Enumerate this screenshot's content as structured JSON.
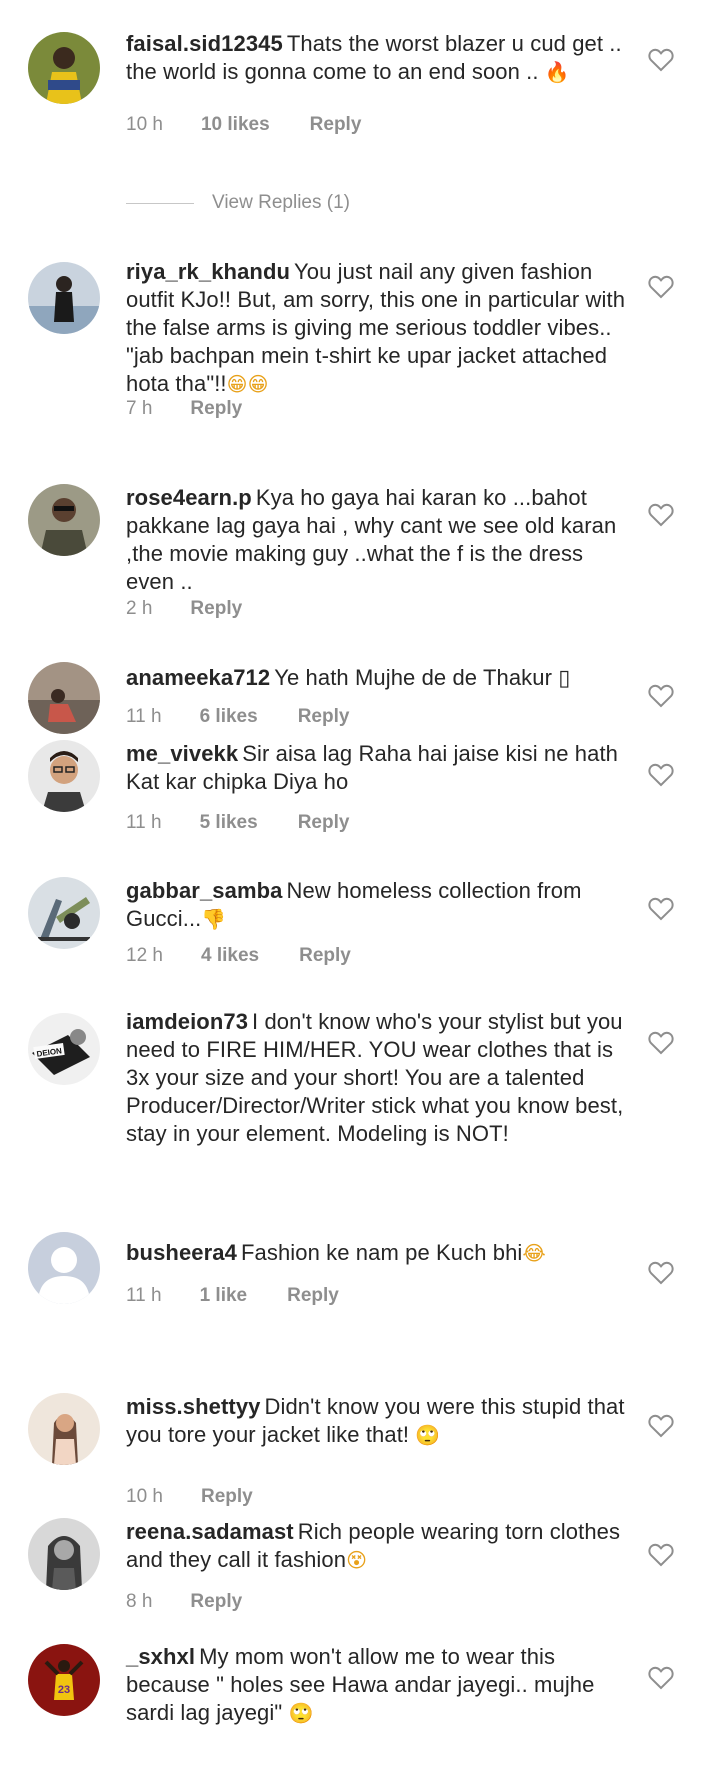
{
  "view_replies_label": "View Replies (1)",
  "comments": [
    {
      "username": "faisal.sid12345",
      "text": "Thats the worst blazer u cud get .. the world is gonna come to an end soon .. ",
      "emoji": "🔥",
      "time": "10 h",
      "likes": "10 likes",
      "reply": "Reply"
    },
    {
      "username": "riya_rk_khandu",
      "text": "You just nail any given fashion outfit KJo!! But, am sorry, this one in particular with the false arms is giving me serious toddler vibes.. \"jab bachpan mein t-shirt ke upar jacket attached hota tha\"!!",
      "emoji": "😁😁",
      "time": "7 h",
      "likes": "",
      "reply": "Reply"
    },
    {
      "username": "rose4earn.p",
      "text": "Kya ho gaya hai karan ko ...bahot pakkane lag gaya hai , why cant we see old karan ,the movie making guy ..what the f is the dress even ..",
      "emoji": "",
      "time": "2 h",
      "likes": "",
      "reply": "Reply"
    },
    {
      "username": "anameeka712",
      "text": "Ye hath Mujhe de de Thakur ",
      "emoji": "▯",
      "time": "11 h",
      "likes": "6 likes",
      "reply": "Reply"
    },
    {
      "username": "me_vivekk",
      "text": "Sir aisa lag Raha hai jaise kisi ne hath Kat kar chipka Diya ho",
      "emoji": "",
      "time": "11 h",
      "likes": "5 likes",
      "reply": "Reply"
    },
    {
      "username": "gabbar_samba",
      "text": "New homeless collection from Gucci...",
      "emoji": "👎",
      "time": "12 h",
      "likes": "4 likes",
      "reply": "Reply"
    },
    {
      "username": "iamdeion73",
      "text": "I don't know who's your stylist but you need to FIRE HIM/HER. YOU wear clothes that is 3x your size and your short! You are a talented Producer/Director/Writer stick what you know best, stay in your element. Modeling is NOT!",
      "emoji": "",
      "time": "",
      "likes": "",
      "reply": ""
    },
    {
      "username": "busheera4",
      "text": "Fashion ke nam pe Kuch bhi",
      "emoji": "😂",
      "time": "11 h",
      "likes": "1 like",
      "reply": "Reply"
    },
    {
      "username": "miss.shettyy",
      "text": "Didn't know you were this stupid that you tore your jacket like that! ",
      "emoji": "🙄",
      "time": "10 h",
      "likes": "",
      "reply": "Reply"
    },
    {
      "username": "reena.sadamast",
      "text": "Rich people wearing torn clothes and they call  it fashion",
      "emoji": "😵",
      "time": "8 h",
      "likes": "",
      "reply": "Reply"
    },
    {
      "username": "_sxhxl",
      "text": "My mom won't allow me to wear this because \" holes see Hawa andar jayegi.. mujhe sardi lag jayegi\" ",
      "emoji": "🙄",
      "time": "",
      "likes": "",
      "reply": ""
    }
  ],
  "avatar_text": {
    "iamdeion73": "DEION",
    "_sxhxl": "23"
  },
  "colors": {
    "text": "#262626",
    "meta": "#8e8e8e",
    "heart": "#8e8e8e",
    "divider": "#c7c7c7"
  }
}
